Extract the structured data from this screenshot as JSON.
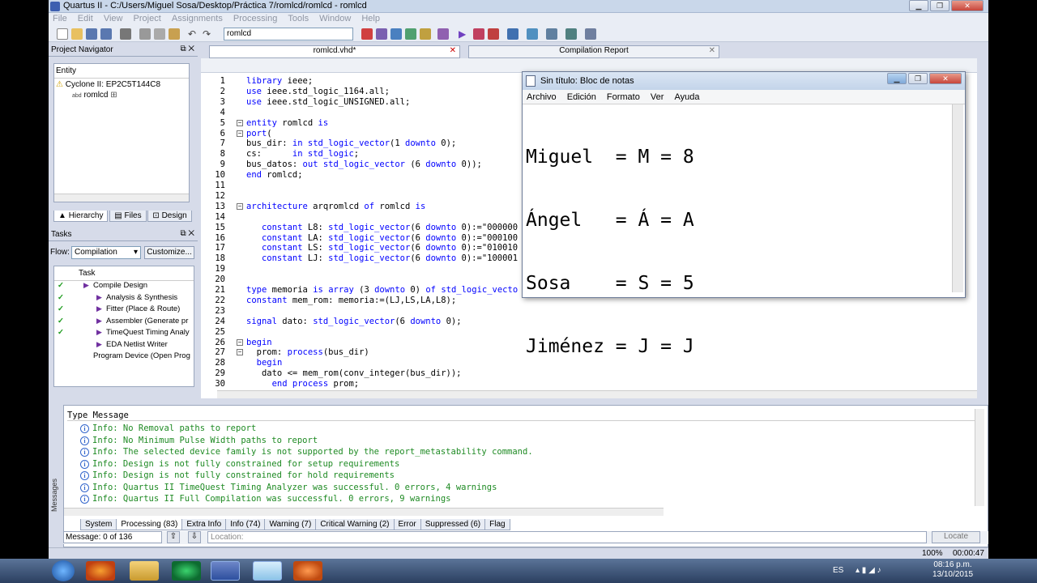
{
  "window": {
    "title": "Quartus II - C:/Users/Miguel Sosa/Desktop/Práctica 7/romlcd/romlcd - romlcd"
  },
  "menu": [
    "File",
    "Edit",
    "View",
    "Project",
    "Assignments",
    "Processing",
    "Tools",
    "Window",
    "Help"
  ],
  "toolbar": {
    "entity_select": "romlcd"
  },
  "project_navigator": {
    "title": "Project Navigator",
    "entity_header": "Entity",
    "device": "Cyclone II: EP2C5T144C8",
    "top_entity": "romlcd",
    "tabs": [
      "Hierarchy",
      "Files",
      "Design"
    ]
  },
  "tasks": {
    "title": "Tasks",
    "flow_label": "Flow:",
    "flow_value": "Compilation",
    "customize_label": "Customize...",
    "column": "Task",
    "items": [
      {
        "label": "Compile Design",
        "done": true
      },
      {
        "label": "Analysis & Synthesis",
        "done": true
      },
      {
        "label": "Fitter (Place & Route)",
        "done": true
      },
      {
        "label": "Assembler (Generate pr",
        "done": true
      },
      {
        "label": "TimeQuest Timing Analy",
        "done": true
      },
      {
        "label": "EDA Netlist Writer",
        "done": false
      },
      {
        "label": "Program Device (Open Prog",
        "done": false
      }
    ]
  },
  "editor": {
    "tab_file": "romlcd.vhd*",
    "tab_report": "Compilation Report",
    "lines": [
      {
        "n": "1",
        "html": "<span class='kw'>library</span> ieee;"
      },
      {
        "n": "2",
        "html": "<span class='kw'>use</span> ieee.std_logic_1164.all;"
      },
      {
        "n": "3",
        "html": "<span class='kw'>use</span> ieee.std_logic_UNSIGNED.all;"
      },
      {
        "n": "4",
        "html": ""
      },
      {
        "n": "5",
        "html": "<span class='kw'>entity</span> romlcd <span class='kw'>is</span>"
      },
      {
        "n": "6",
        "html": "<span class='kw'>port</span>("
      },
      {
        "n": "7",
        "html": "bus_dir: <span class='kw'>in</span> <span class='kw'>std_logic_vector</span>(1 <span class='kw'>downto</span> 0);"
      },
      {
        "n": "8",
        "html": "cs:      <span class='kw'>in</span> <span class='kw'>std_logic</span>;"
      },
      {
        "n": "9",
        "html": "bus_datos: <span class='kw'>out</span> <span class='kw'>std_logic_vector</span> (6 <span class='kw'>downto</span> 0));"
      },
      {
        "n": "10",
        "html": "<span class='kw'>end</span> romlcd;"
      },
      {
        "n": "11",
        "html": ""
      },
      {
        "n": "12",
        "html": ""
      },
      {
        "n": "13",
        "html": "<span class='kw'>architecture</span> arqromlcd <span class='kw'>of</span> romlcd <span class='kw'>is</span>"
      },
      {
        "n": "14",
        "html": ""
      },
      {
        "n": "15",
        "html": "   <span class='kw'>constant</span> L8: <span class='kw'>std_logic_vector</span>(6 <span class='kw'>downto</span> 0):=\"000000"
      },
      {
        "n": "16",
        "html": "   <span class='kw'>constant</span> LA: <span class='kw'>std_logic_vector</span>(6 <span class='kw'>downto</span> 0):=\"000100"
      },
      {
        "n": "17",
        "html": "   <span class='kw'>constant</span> LS: <span class='kw'>std_logic_vector</span>(6 <span class='kw'>downto</span> 0):=\"010010"
      },
      {
        "n": "18",
        "html": "   <span class='kw'>constant</span> LJ: <span class='kw'>std_logic_vector</span>(6 <span class='kw'>downto</span> 0):=\"100001"
      },
      {
        "n": "19",
        "html": ""
      },
      {
        "n": "20",
        "html": ""
      },
      {
        "n": "21",
        "html": "<span class='kw'>type</span> memoria <span class='kw'>is</span> <span class='kw'>array</span> (3 <span class='kw'>downto</span> 0) <span class='kw'>of</span> <span class='kw'>std_logic_vecto</span>"
      },
      {
        "n": "22",
        "html": "<span class='kw'>constant</span> mem_rom: memoria:=(LJ,LS,LA,L8);"
      },
      {
        "n": "23",
        "html": ""
      },
      {
        "n": "24",
        "html": "<span class='kw'>signal</span> dato: <span class='kw'>std_logic_vector</span>(6 <span class='kw'>downto</span> 0);"
      },
      {
        "n": "25",
        "html": ""
      },
      {
        "n": "26",
        "html": "<span class='kw'>begin</span>"
      },
      {
        "n": "27",
        "html": "  prom: <span class='kw'>process</span>(bus_dir)"
      },
      {
        "n": "28",
        "html": "  <span class='kw'>begin</span>"
      },
      {
        "n": "29",
        "html": "   dato &lt;= mem_rom(conv_integer(bus_dir));"
      },
      {
        "n": "30",
        "html": "     <span class='kw'>end</span> <span class='kw'>process</span> prom;"
      }
    ]
  },
  "notepad": {
    "title": "Sin título: Bloc de notas",
    "menu": [
      "Archivo",
      "Edición",
      "Formato",
      "Ver",
      "Ayuda"
    ],
    "lines": [
      "Miguel  = M = 8",
      "Ángel   = Á = A",
      "Sosa    = S = 5",
      "Jiménez = J = J"
    ]
  },
  "messages": {
    "header": "Type  Message",
    "items": [
      "Info: No Removal paths to report",
      "Info: No Minimum Pulse Width paths to report",
      "Info: The selected device family is not supported by the report_metastability command.",
      "Info: Design is not fully constrained for setup requirements",
      "Info: Design is not fully constrained for hold requirements",
      "Info: Quartus II TimeQuest Timing Analyzer was successful. 0 errors, 4 warnings",
      "Info: Quartus II Full Compilation was successful. 0 errors, 9 warnings"
    ],
    "tabs": [
      "System",
      "Processing (83)",
      "Extra Info",
      "Info (74)",
      "Warning (7)",
      "Critical Warning (2)",
      "Error",
      "Suppressed (6)",
      "Flag"
    ],
    "side_label": "Messages",
    "count": "Message: 0 of 136",
    "location_placeholder": "Location:",
    "locate": "Locate"
  },
  "status": {
    "zoom": "100%",
    "time": "00:00:47"
  },
  "taskbar": {
    "lang": "ES",
    "clock_time": "08:16 p.m.",
    "clock_date": "13/10/2015"
  }
}
